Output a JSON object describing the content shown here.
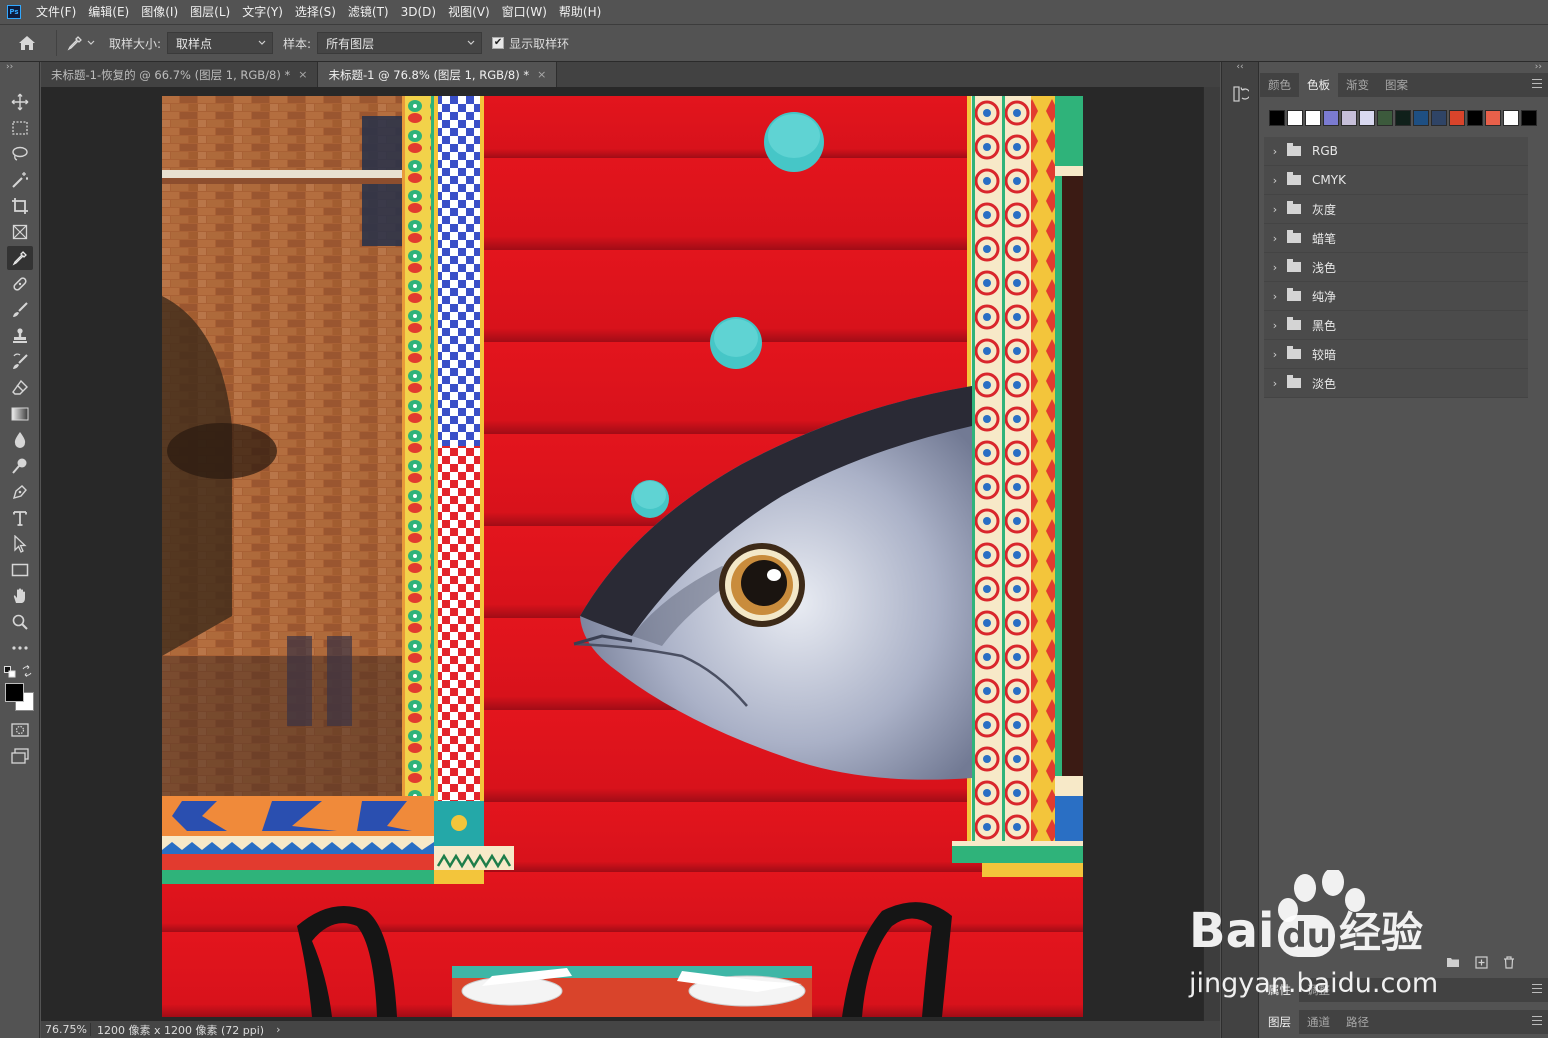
{
  "app": {
    "logo_text": "Ps"
  },
  "menu": [
    "文件(F)",
    "编辑(E)",
    "图像(I)",
    "图层(L)",
    "文字(Y)",
    "选择(S)",
    "滤镜(T)",
    "3D(D)",
    "视图(V)",
    "窗口(W)",
    "帮助(H)"
  ],
  "options": {
    "sample_size_label": "取样大小:",
    "sample_size_value": "取样点",
    "sample_label": "样本:",
    "sample_value": "所有图层",
    "show_ring_label": "显示取样环",
    "show_ring_checked": true
  },
  "tabs": [
    {
      "title": "未标题-1-恢复的 @ 66.7% (图层 1, RGB/8) *",
      "close": "×"
    },
    {
      "title": "未标题-1 @ 76.8% (图层 1, RGB/8) *",
      "close": "×"
    }
  ],
  "status": {
    "zoom": "76.75%",
    "doc_info": "1200 像素 x 1200 像素 (72 ppi)",
    "arrow": "›"
  },
  "panel_tabs": [
    "颜色",
    "色板",
    "渐变",
    "图案"
  ],
  "swatches": [
    "#000000",
    "#ffffff",
    "#ffffff",
    "#7b7bd1",
    "#c6bfd9",
    "#d9d9f0",
    "#3c5a3c",
    "#10201a",
    "#1e4f82",
    "#2f4466",
    "#d9442b",
    "#000000",
    "#e8604a",
    "#ffffff",
    "#000000"
  ],
  "swatch_groups": [
    "RGB",
    "CMYK",
    "灰度",
    "蜡笔",
    "浅色",
    "纯净",
    "黑色",
    "较暗",
    "淡色"
  ],
  "lower_tabs_1": [
    "属性",
    "调整"
  ],
  "lower_tabs_2": [
    "图层",
    "通道",
    "路径"
  ],
  "watermark": {
    "brand": "Bai",
    "brand2": "du",
    "cn": "经验",
    "url": "jingyan.baidu.com"
  }
}
